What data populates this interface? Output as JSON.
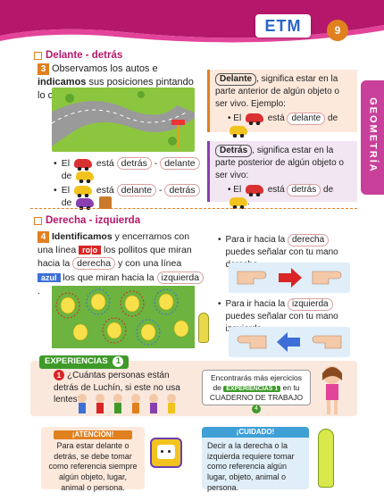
{
  "header": {
    "brand": "ETM",
    "page_number": "9",
    "side_tab": "GEOMETRÍA"
  },
  "section1": {
    "title": "Delante - detrás",
    "exercise_number": "3",
    "instruction_pre": "Observamos los autos e ",
    "instruction_bold": "indicamos",
    "instruction_post": " sus posiciones pintando lo correcto.",
    "item1": {
      "pre": "El",
      "mid": "está",
      "opt1": "detrás",
      "sep": "-",
      "opt2": "delante",
      "post": "de"
    },
    "item2": {
      "pre": "El",
      "mid": "está",
      "opt1": "delante",
      "sep": "-",
      "opt2": "detrás",
      "post": "de"
    },
    "def_front": {
      "word": "Delante",
      "text": ", significa estar en la parte anterior de algún objeto o ser vivo. Ejemplo:",
      "ex_pre": "El",
      "ex_mid": "está",
      "ex_word": "delante",
      "ex_post": "de"
    },
    "def_back": {
      "word": "Detrás",
      "text": ", significa estar en la parte posterior de algún objeto o ser vivo:",
      "ex_pre": "El",
      "ex_mid": "está",
      "ex_word": "detrás",
      "ex_post": "de",
      "ex_end": "."
    }
  },
  "section2": {
    "title": "Derecha - izquierda",
    "exercise_number": "4",
    "text_bold": "Identificamos",
    "text1": " y encerramos con una línea ",
    "tag_red": "rojo",
    "text2": " los pollitos que miran hacia la ",
    "word_right": "derecha",
    "text3": " y con una línea ",
    "tag_blue": "azul",
    "text4": " los que miran hacia la ",
    "word_left": "izquierda",
    "text5": ".",
    "right_pre": "Para ir hacia la ",
    "right_word": "derecha",
    "right_post": " puedes señalar con tu mano derecha.",
    "left_pre": "Para ir hacia la ",
    "left_word": "izquierda",
    "left_post": " puedes señalar con tu mano izquierda."
  },
  "experience": {
    "label": "EXPERIENCIAS",
    "label_num": "1",
    "question_num": "1",
    "question": "¿Cuántas personas están detrás de Luchín, si este no usa lentes?:",
    "note1": "Encontrarás más ejercicios de",
    "note_tag": "EXPERIENCIAS 1",
    "note2": " en tu CUADERNO DE TRABAJO",
    "note_num": "4"
  },
  "attention": {
    "title": "¡ATENCIÓN!",
    "text": "Para estar delante o detrás, se debe tomar como referencia siempre algún objeto, lugar, animal o persona."
  },
  "careful": {
    "title": "¡CUIDADO!",
    "text": "Decir a la derecha o la izquierda requiere tomar como referencia algún lugar, objeto, animal o persona."
  },
  "colors": {
    "magenta": "#b5176a",
    "orange": "#e0801f",
    "green": "#3f9a2a",
    "lilac": "#f1e6f2",
    "peach": "#fde9dc"
  }
}
